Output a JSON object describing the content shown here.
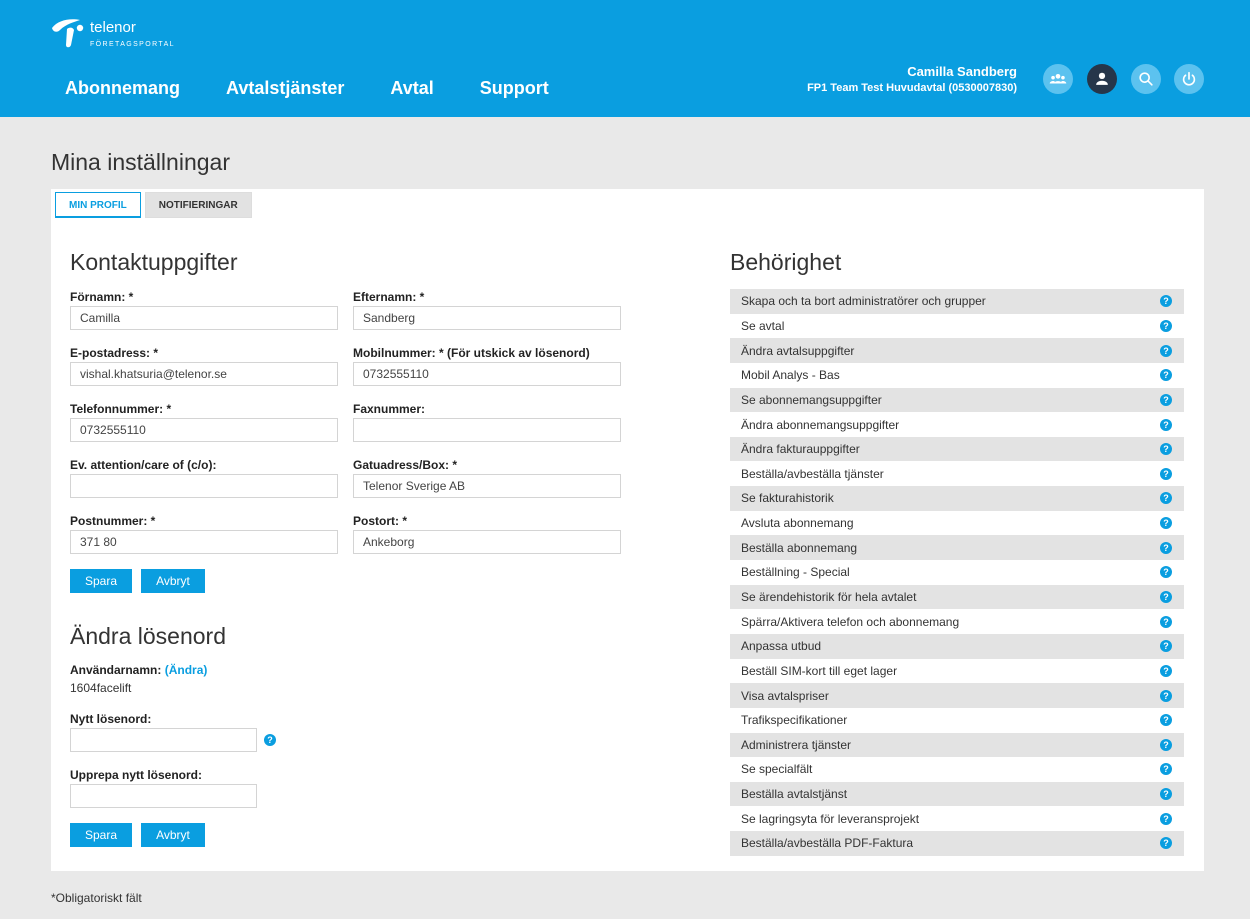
{
  "brand": {
    "name": "telenor",
    "sub": "FÖRETAGSPORTAL",
    "logo_color": "#ffffff"
  },
  "colors": {
    "header": "#0a9ee0",
    "accent": "#0a9ee0",
    "page_bg": "#e9e9e9"
  },
  "nav": {
    "items": [
      "Abonnemang",
      "Avtalstjänster",
      "Avtal",
      "Support"
    ]
  },
  "user": {
    "name": "Camilla Sandberg",
    "agreement": "FP1 Team Test Huvudavtal (0530007830)"
  },
  "header_icons": [
    "users-group-icon",
    "user-icon",
    "search-icon",
    "power-icon"
  ],
  "page": {
    "title": "Mina inställningar"
  },
  "tabs": [
    {
      "label": "MIN PROFIL",
      "active": true
    },
    {
      "label": "NOTIFIERINGAR",
      "active": false
    }
  ],
  "contact": {
    "title": "Kontaktuppgifter",
    "fields": {
      "first_name": {
        "label": "Förnamn: *",
        "value": "Camilla"
      },
      "last_name": {
        "label": "Efternamn: *",
        "value": "Sandberg"
      },
      "email": {
        "label": "E-postadress: *",
        "value": "vishal.khatsuria@telenor.se"
      },
      "mobile": {
        "label": "Mobilnummer: * (För utskick av lösenord)",
        "value": "0732555110"
      },
      "phone": {
        "label": "Telefonnummer: *",
        "value": "0732555110"
      },
      "fax": {
        "label": "Faxnummer:",
        "value": ""
      },
      "attention": {
        "label": "Ev. attention/care of (c/o):",
        "value": ""
      },
      "street": {
        "label": "Gatuadress/Box: *",
        "value": "Telenor Sverige AB"
      },
      "zip": {
        "label": "Postnummer: *",
        "value": "371 80"
      },
      "city": {
        "label": "Postort: *",
        "value": "Ankeborg"
      }
    },
    "save_label": "Spara",
    "cancel_label": "Avbryt"
  },
  "password": {
    "title": "Ändra lösenord",
    "username_label": "Användarnamn:",
    "change_link": "(Ändra)",
    "username_value": "1604facelift",
    "new_label": "Nytt lösenord:",
    "repeat_label": "Upprepa nytt lösenord:",
    "save_label": "Spara",
    "cancel_label": "Avbryt"
  },
  "permissions": {
    "title": "Behörighet",
    "items": [
      "Skapa och ta bort administratörer och grupper",
      "Se avtal",
      "Ändra avtalsuppgifter",
      "Mobil Analys - Bas",
      "Se abonnemangsuppgifter",
      "Ändra abonnemangsuppgifter",
      "Ändra fakturauppgifter",
      "Beställa/avbeställa tjänster",
      "Se fakturahistorik",
      "Avsluta abonnemang",
      "Beställa abonnemang",
      "Beställning - Special",
      "Se ärendehistorik för hela avtalet",
      "Spärra/Aktivera telefon och abonnemang",
      "Anpassa utbud",
      "Beställ SIM-kort till eget lager",
      "Visa avtalspriser",
      "Trafikspecifikationer",
      "Administrera tjänster",
      "Se specialfält",
      "Beställa avtalstjänst",
      "Se lagringsyta för leveransprojekt",
      "Beställa/avbeställa PDF-Faktura"
    ]
  },
  "footer": {
    "note": "*Obligatoriskt fält"
  }
}
